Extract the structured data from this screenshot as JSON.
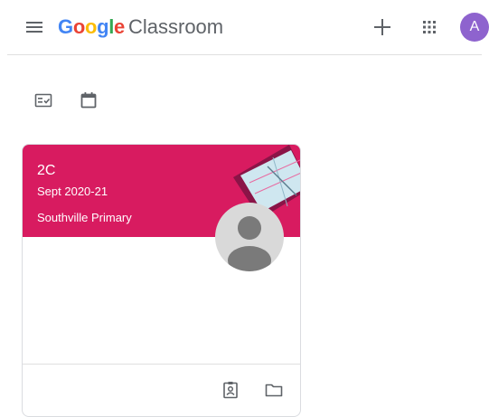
{
  "header": {
    "brand_google_letters": [
      "G",
      "o",
      "o",
      "g",
      "l",
      "e"
    ],
    "brand_product": "Classroom",
    "menu_icon": "hamburger-menu-icon",
    "add_icon": "plus-icon",
    "apps_icon": "apps-grid-icon",
    "account_initial": "A",
    "account_color": "#8e63ce"
  },
  "toolbar": {
    "todo_icon": "to-do-checklist-icon",
    "calendar_icon": "calendar-icon"
  },
  "class_card": {
    "name": "2C",
    "section": "Sept 2020-21",
    "school": "Southville Primary",
    "header_color": "#d81b60",
    "footer_icons": [
      "assigned-work-icon",
      "folder-icon"
    ]
  }
}
